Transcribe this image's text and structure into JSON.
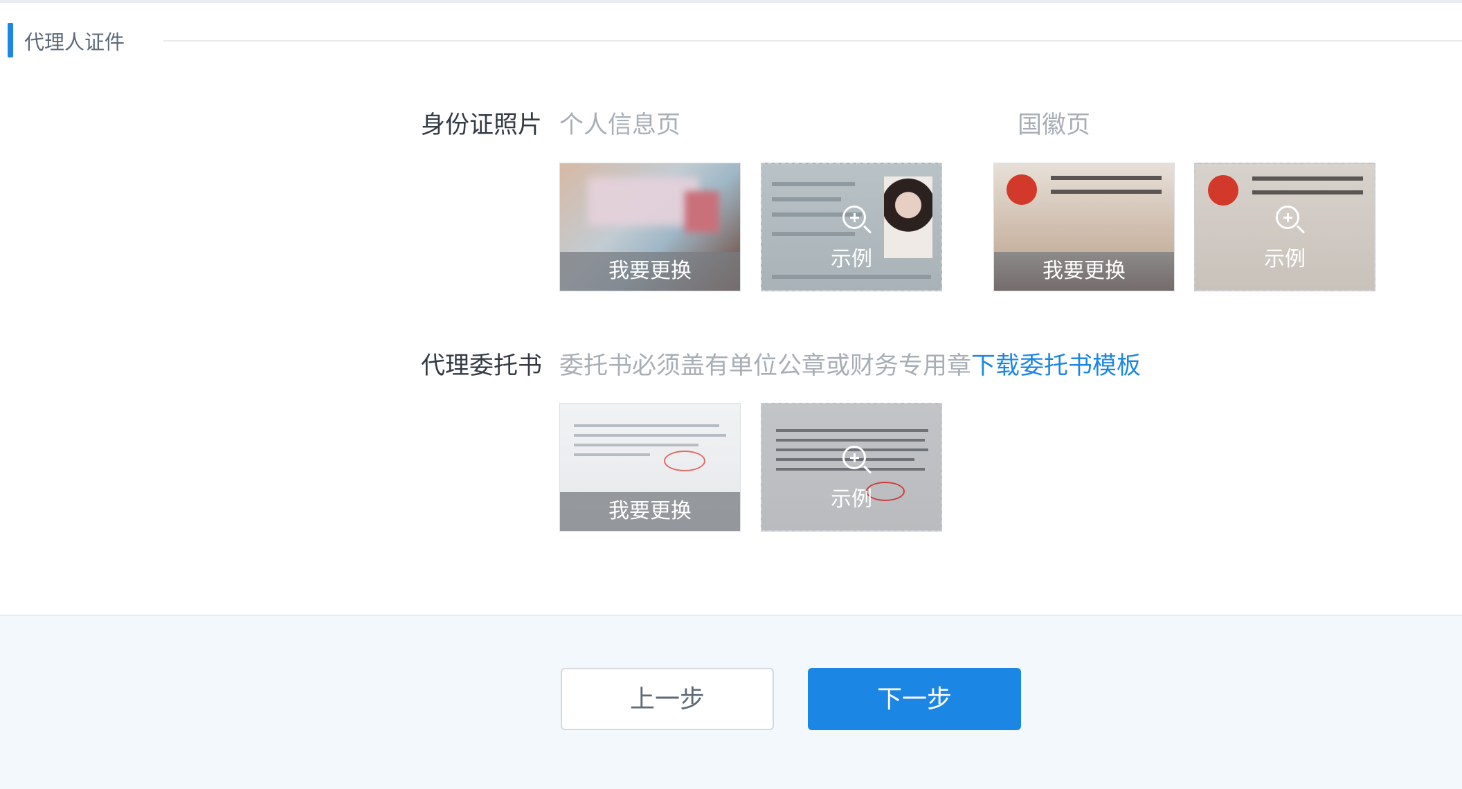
{
  "section": {
    "title": "代理人证件"
  },
  "id_photo": {
    "label": "身份证照片",
    "front_caption": "个人信息页",
    "back_caption": "国徽页",
    "replace_label": "我要更换",
    "sample_label": "示例"
  },
  "authorization": {
    "label": "代理委托书",
    "hint": "委托书必须盖有单位公章或财务专用章",
    "download_link": "下载委托书模板",
    "replace_label": "我要更换",
    "sample_label": "示例"
  },
  "footer": {
    "prev_label": "上一步",
    "next_label": "下一步"
  },
  "colors": {
    "accent": "#1c86e4",
    "footer_bg": "#f2f8fc"
  }
}
